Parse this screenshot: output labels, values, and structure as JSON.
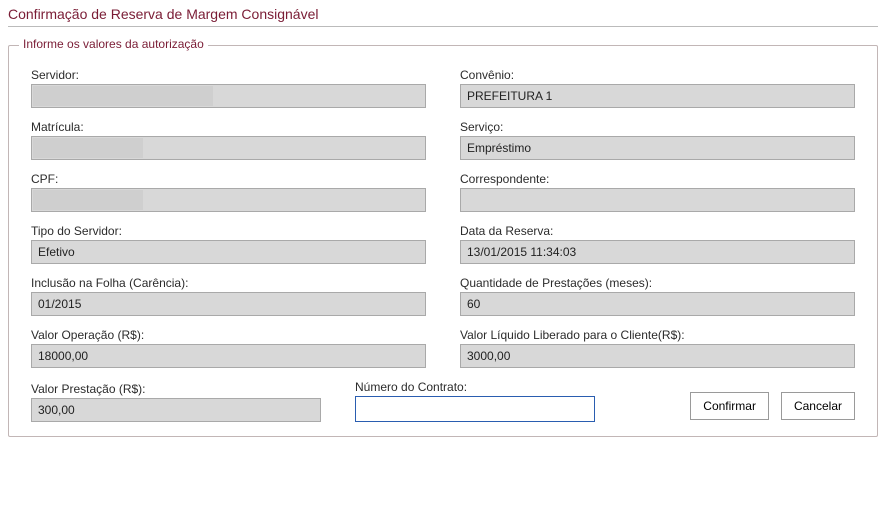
{
  "page": {
    "title": "Confirmação de Reserva de Margem Consignável"
  },
  "fieldset": {
    "legend": "Informe os valores da autorização"
  },
  "left": {
    "servidor": {
      "label": "Servidor:",
      "value": ""
    },
    "matricula": {
      "label": "Matrícula:",
      "value": ""
    },
    "cpf": {
      "label": "CPF:",
      "value": ""
    },
    "tipo_servidor": {
      "label": "Tipo do Servidor:",
      "value": "Efetivo"
    },
    "inclusao_folha": {
      "label": "Inclusão na Folha (Carência):",
      "value": "01/2015"
    },
    "valor_operacao": {
      "label": "Valor Operação (R$):",
      "value": "18000,00"
    },
    "valor_prestacao": {
      "label": "Valor Prestação (R$):",
      "value": "300,00"
    }
  },
  "right": {
    "convenio": {
      "label": "Convênio:",
      "value": "PREFEITURA 1"
    },
    "servico": {
      "label": "Serviço:",
      "value": "Empréstimo"
    },
    "correspondente": {
      "label": "Correspondente:",
      "value": ""
    },
    "data_reserva": {
      "label": "Data da Reserva:",
      "value": "13/01/2015 11:34:03"
    },
    "qtd_prestacoes": {
      "label": "Quantidade de Prestações (meses):",
      "value": "60"
    },
    "valor_liquido": {
      "label": "Valor Líquido Liberado para o Cliente(R$):",
      "value": "3000,00"
    }
  },
  "contrato": {
    "label": "Número do Contrato:",
    "value": ""
  },
  "buttons": {
    "confirm": "Confirmar",
    "cancel": "Cancelar"
  }
}
